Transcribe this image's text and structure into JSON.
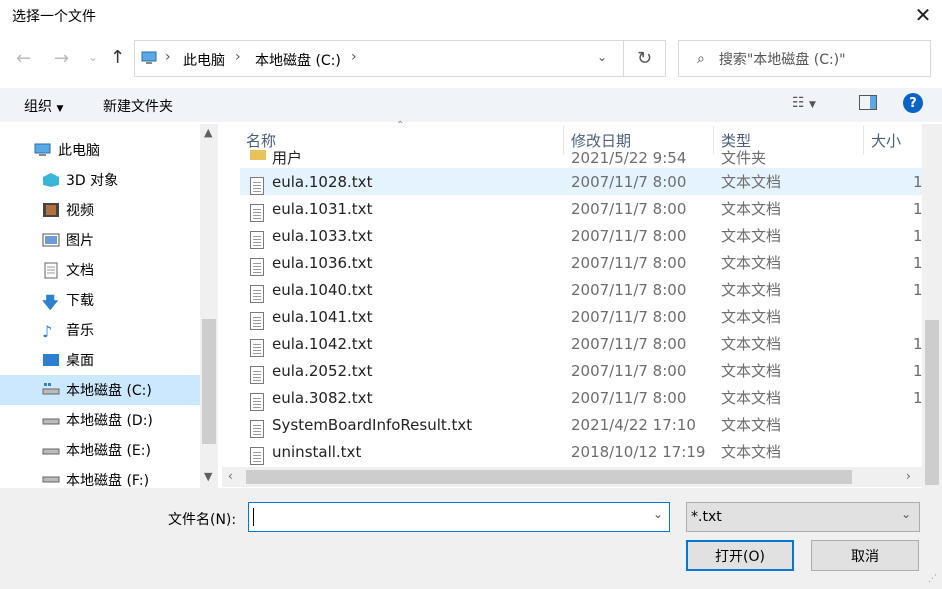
{
  "window": {
    "title": "选择一个文件"
  },
  "address": {
    "crumbs": [
      "此电脑",
      "本地磁盘 (C:)"
    ]
  },
  "search": {
    "placeholder": "搜索\"本地磁盘 (C:)\""
  },
  "toolbar": {
    "organize": "组织",
    "new_folder": "新建文件夹",
    "help": "?"
  },
  "nav": {
    "items": [
      {
        "label": "此电脑",
        "icon": "computer-icon"
      },
      {
        "label": "3D 对象",
        "icon": "cube-icon"
      },
      {
        "label": "视频",
        "icon": "video-icon"
      },
      {
        "label": "图片",
        "icon": "picture-icon"
      },
      {
        "label": "文档",
        "icon": "document-icon"
      },
      {
        "label": "下载",
        "icon": "download-icon"
      },
      {
        "label": "音乐",
        "icon": "music-icon"
      },
      {
        "label": "桌面",
        "icon": "desktop-icon"
      },
      {
        "label": "本地磁盘 (C:)",
        "icon": "drive-icon",
        "selected": true
      },
      {
        "label": "本地磁盘 (D:)",
        "icon": "drive-icon"
      },
      {
        "label": "本地磁盘 (E:)",
        "icon": "drive-icon"
      },
      {
        "label": "本地磁盘 (F:)",
        "icon": "drive-icon"
      }
    ]
  },
  "columns": {
    "name": "名称",
    "date": "修改日期",
    "type": "类型",
    "size": "大小"
  },
  "partial_row": {
    "name": "用户",
    "date": "2021/5/22 9:54",
    "type": "文件夹"
  },
  "files": [
    {
      "name": "eula.1028.txt",
      "date": "2007/11/7 8:00",
      "type": "文本文档",
      "size": "1"
    },
    {
      "name": "eula.1031.txt",
      "date": "2007/11/7 8:00",
      "type": "文本文档",
      "size": "1"
    },
    {
      "name": "eula.1033.txt",
      "date": "2007/11/7 8:00",
      "type": "文本文档",
      "size": "1"
    },
    {
      "name": "eula.1036.txt",
      "date": "2007/11/7 8:00",
      "type": "文本文档",
      "size": "1"
    },
    {
      "name": "eula.1040.txt",
      "date": "2007/11/7 8:00",
      "type": "文本文档",
      "size": "1"
    },
    {
      "name": "eula.1041.txt",
      "date": "2007/11/7 8:00",
      "type": "文本文档",
      "size": ""
    },
    {
      "name": "eula.1042.txt",
      "date": "2007/11/7 8:00",
      "type": "文本文档",
      "size": "1"
    },
    {
      "name": "eula.2052.txt",
      "date": "2007/11/7 8:00",
      "type": "文本文档",
      "size": "1"
    },
    {
      "name": "eula.3082.txt",
      "date": "2007/11/7 8:00",
      "type": "文本文档",
      "size": "1"
    },
    {
      "name": "SystemBoardInfoResult.txt",
      "date": "2021/4/22 17:10",
      "type": "文本文档",
      "size": ""
    },
    {
      "name": "uninstall.txt",
      "date": "2018/10/12 17:19",
      "type": "文本文档",
      "size": ""
    }
  ],
  "filename": {
    "label": "文件名(N):",
    "value": ""
  },
  "filter": {
    "value": "*.txt"
  },
  "buttons": {
    "open": "打开(O)",
    "cancel": "取消"
  },
  "colors": {
    "selection": "#cce8ff",
    "hover": "#e5f3ff",
    "accent": "#0078d7"
  }
}
